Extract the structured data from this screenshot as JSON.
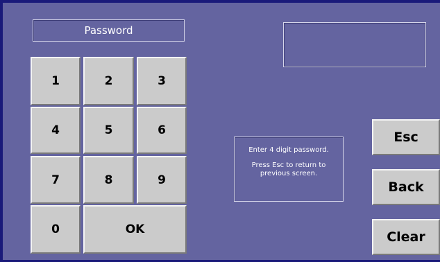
{
  "title": "Password",
  "display_value": "",
  "keypad": {
    "row1": [
      "1",
      "2",
      "3"
    ],
    "row2": [
      "4",
      "5",
      "6"
    ],
    "row3": [
      "7",
      "8",
      "9"
    ],
    "zero": "0",
    "ok": "OK"
  },
  "actions": {
    "esc": "Esc",
    "back": "Back",
    "clear": "Clear"
  },
  "info": {
    "line1": "Enter 4 digit password.",
    "line2": "Press Esc to return to previous screen."
  },
  "colors": {
    "background": "#6464a0",
    "frame": "#1a1a7a",
    "button_face": "#cbcbcb"
  }
}
